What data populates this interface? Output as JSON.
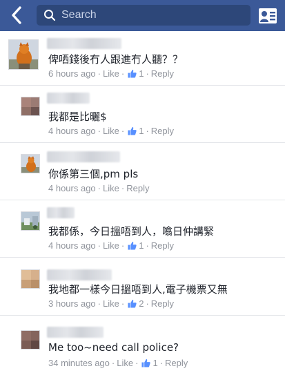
{
  "header": {
    "search_placeholder": "Search",
    "colors": {
      "bar": "#3b5998",
      "search_bg": "#2d4779"
    }
  },
  "comments": [
    {
      "text": "俾哂錢後冇人跟進冇人聽？？",
      "time": "6 hours ago",
      "like_label": "Like",
      "like_count": "1",
      "reply_label": "Reply",
      "avatar": "orange-cat-photo"
    },
    {
      "text": "我都是比曬$",
      "time": "4 hours ago",
      "like_label": "Like",
      "like_count": "1",
      "reply_label": "Reply",
      "avatar": "blurred-photo"
    },
    {
      "text": "你係第三個,pm pls",
      "time": "4 hours ago",
      "like_label": "Like",
      "like_count": "",
      "reply_label": "Reply",
      "avatar": "orange-cat-photo"
    },
    {
      "text": "我都係，今日搵唔到人，噏日仲講緊",
      "time": "4 hours ago",
      "like_label": "Like",
      "like_count": "1",
      "reply_label": "Reply",
      "avatar": "outdoor-photo"
    },
    {
      "text": "我地都一樣今日搵唔到人,電子機票又無",
      "time": "3 hours ago",
      "like_label": "Like",
      "like_count": "2",
      "reply_label": "Reply",
      "avatar": "blurred-photo"
    },
    {
      "text": "Me too~need call police?",
      "time": "34 minutes ago",
      "like_label": "Like",
      "like_count": "1",
      "reply_label": "Reply",
      "avatar": "blurred-photo"
    }
  ]
}
